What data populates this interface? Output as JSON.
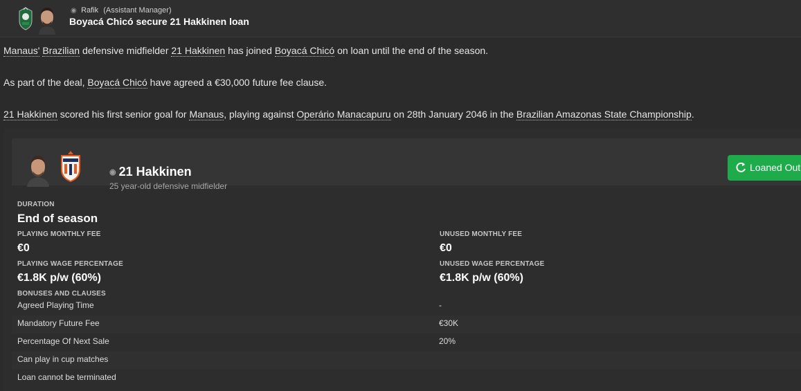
{
  "message": {
    "sender_name": "Rafik",
    "sender_role": "(Assistant Manager)",
    "headline": "Boyacá Chicó secure 21 Hakkinen loan"
  },
  "body": {
    "p1": {
      "link1": "Manaus'",
      "t1": " ",
      "link2": "Brazilian",
      "t2": " defensive midfielder ",
      "link3": "21 Hakkinen",
      "t3": " has joined ",
      "link4": "Boyacá Chicó",
      "t4": " on loan until the end of the season."
    },
    "p2": {
      "t1": "As part of the deal, ",
      "link1": "Boyacá Chicó",
      "t2": " have agreed a €30,000 future fee clause."
    },
    "p3": {
      "link1": "21 Hakkinen",
      "t1": " scored his first senior goal for ",
      "link2": "Manaus",
      "t2": ", playing against ",
      "link3": "Operário Manacapuru",
      "t3": " on 28th January 2046 in the ",
      "link4": "Brazilian Amazonas State Championship",
      "t4": "."
    }
  },
  "card": {
    "player_name": "21 Hakkinen",
    "player_desc": "25 year-old defensive midfielder",
    "button_label": "Loaned Out",
    "button_color": "#1eac4b",
    "duration_label": "DURATION",
    "duration_value": "End of season",
    "playing_fee_label": "PLAYING MONTHLY FEE",
    "playing_fee_value": "€0",
    "unused_fee_label": "UNUSED MONTHLY FEE",
    "unused_fee_value": "€0",
    "playing_wage_label": "PLAYING WAGE PERCENTAGE",
    "playing_wage_value": "€1.8K p/w (60%)",
    "unused_wage_label": "UNUSED WAGE PERCENTAGE",
    "unused_wage_value": "€1.8K p/w (60%)",
    "bonuses_label": "BONUSES AND CLAUSES",
    "clauses": [
      {
        "label": "Agreed Playing Time",
        "value": "-"
      },
      {
        "label": "Mandatory Future Fee",
        "value": "€30K"
      },
      {
        "label": "Percentage Of Next Sale",
        "value": "20%"
      },
      {
        "label": "Can play in cup matches",
        "value": ""
      },
      {
        "label": "Loan cannot be terminated",
        "value": ""
      }
    ]
  }
}
